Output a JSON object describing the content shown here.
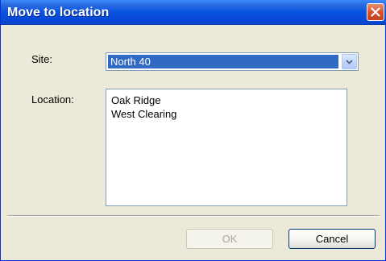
{
  "window": {
    "title": "Move to location",
    "close_icon": "close-icon"
  },
  "form": {
    "site_label": "Site:",
    "site_value": "North 40",
    "dropdown_icon": "chevron-down-icon",
    "location_label": "Location:",
    "locations": [
      "Oak Ridge",
      "West Clearing"
    ]
  },
  "buttons": {
    "ok_label": "OK",
    "ok_enabled": false,
    "cancel_label": "Cancel"
  },
  "colors": {
    "titlebar": "#0a54e3",
    "selection": "#316ac5",
    "close_button": "#d6532c",
    "dialog_background": "#ece9d8"
  }
}
